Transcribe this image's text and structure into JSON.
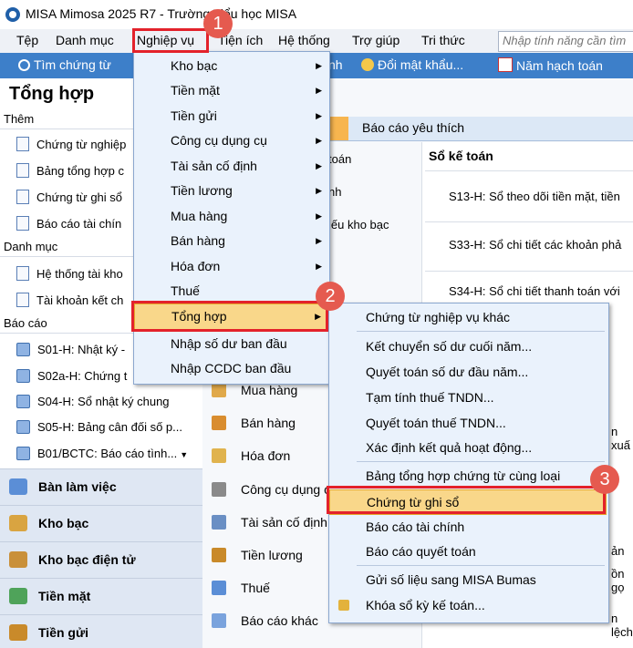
{
  "window": {
    "title": "MISA Mimosa 2025 R7 - Trường Tiểu học MISA"
  },
  "menubar": {
    "items": [
      "Tệp",
      "Danh mục",
      "Nghiệp vụ",
      "Tiện ích",
      "Hệ thống",
      "Trợ giúp",
      "Tri thức"
    ]
  },
  "search": {
    "placeholder": "Nhập tính năng cần tìm"
  },
  "toolbar": {
    "items": [
      "Tìm chứng từ",
      "nh",
      "Đổi mật khẩu...",
      "Năm hạch toán"
    ]
  },
  "left_panel": {
    "title": "Tổng hợp",
    "sections": {
      "them": "Thêm",
      "danh_muc": "Danh mục",
      "bao_cao": "Báo cáo"
    },
    "them_items": [
      "Chứng từ nghiệp",
      "Bảng tổng hợp c",
      "Chứng từ ghi sổ",
      "Báo cáo tài chín"
    ],
    "danh_muc_items": [
      "Hệ thống tài kho",
      "Tài khoản kết ch"
    ],
    "bao_cao_items": [
      "S01-H: Nhật ký -",
      "S02a-H: Chứng t",
      "S04-H: Sổ nhật ký chung",
      "S05-H: Bảng cân đối số p...",
      "B01/BCTC: Báo cáo tình..."
    ],
    "nav_buttons": [
      "Bàn làm việc",
      "Kho bạc",
      "Kho bạc điện tử",
      "Tiền mặt",
      "Tiền gửi"
    ]
  },
  "center": {
    "tab_fav": "Báo cáo yêu thích",
    "fragments": [
      "toán",
      "nh",
      "iếu kho bạc"
    ],
    "items": [
      "Mua hàng",
      "Bán hàng",
      "Hóa đơn",
      "Công cụ dụng c",
      "Tài sản cố định",
      "Tiền lương",
      "Thuế",
      "Báo cáo khác"
    ]
  },
  "right_panel": {
    "heading": "Sổ kế toán",
    "rows": [
      "S13-H: Sổ theo dõi tiền mặt, tiền",
      "S33-H: Sổ chi tiết các khoản phả",
      "S34-H: Sổ chi tiết thanh toán với",
      "n xuấ",
      "ản",
      "ồn gọ",
      "n lệch"
    ]
  },
  "menu_nghiep_vu": {
    "items": [
      "Kho bạc",
      "Tiền mặt",
      "Tiền gửi",
      "Công cụ dụng cụ",
      "Tài sản cố định",
      "Tiền lương",
      "Mua hàng",
      "Bán hàng",
      "Hóa đơn",
      "Thuế",
      "Tổng hợp",
      "Nhập số dư ban đầu",
      "Nhập CCDC ban đầu"
    ],
    "has_submenu": [
      true,
      true,
      true,
      true,
      true,
      true,
      true,
      true,
      true,
      false,
      true,
      false,
      false
    ],
    "highlighted": "Tổng hợp"
  },
  "menu_tong_hop": {
    "items": [
      "Chứng từ nghiệp vụ khác",
      "Kết chuyển số dư cuối năm...",
      "Quyết toán số dư đầu năm...",
      "Tạm tính thuế TNDN...",
      "Quyết toán thuế TNDN...",
      "Xác định kết quả hoạt động...",
      "Bảng tổng hợp chứng từ cùng loại",
      "Chứng từ ghi sổ",
      "Báo cáo tài chính",
      "Báo cáo quyết toán",
      "Gửi số liệu sang MISA Bumas",
      "Khóa sổ kỳ kế toán..."
    ],
    "highlighted": "Chứng từ ghi sổ"
  },
  "badges": [
    "1",
    "2",
    "3"
  ],
  "colors": {
    "toolbar": "#3d7fc9",
    "highlight": "#f9d78a",
    "annotation_red": "#e3222b",
    "badge": "#e55a4f"
  }
}
